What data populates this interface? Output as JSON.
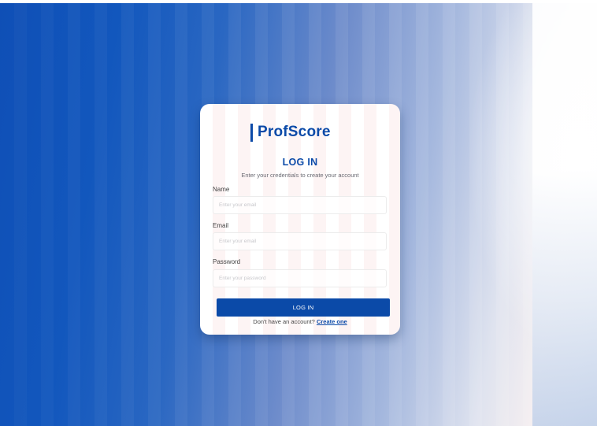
{
  "brand": {
    "name": "ProfScore",
    "color": "#0b4aa8"
  },
  "form": {
    "title": "LOG IN",
    "subtitle": "Enter your credentials to create your account",
    "fields": [
      {
        "label": "Name",
        "placeholder": "Enter your email",
        "value": ""
      },
      {
        "label": "Email",
        "placeholder": "Enter your email",
        "value": ""
      },
      {
        "label": "Password",
        "placeholder": "Enter your password",
        "value": ""
      }
    ],
    "submit_label": "LOG IN",
    "signup_prompt": "Don't have an account?",
    "signup_link": "Create one"
  },
  "colors": {
    "accent": "#0b4aa8",
    "background_start": "#0f4fb6",
    "background_end": "#c9d6ec"
  }
}
